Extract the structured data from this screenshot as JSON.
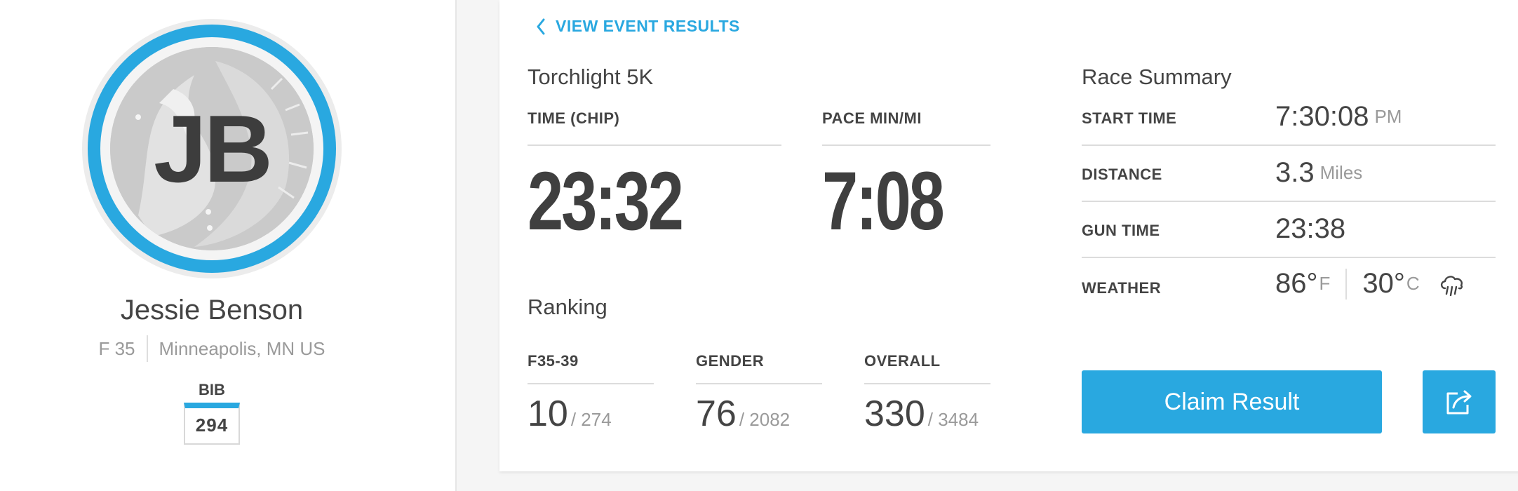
{
  "athlete": {
    "initials": "JB",
    "name": "Jessie Benson",
    "division": "F 35",
    "location": "Minneapolis, MN US",
    "bib_label": "BIB",
    "bib_number": "294"
  },
  "nav": {
    "back_label": "VIEW EVENT RESULTS",
    "back_icon": "chevron-left-icon"
  },
  "result": {
    "event_name": "Torchlight 5K",
    "time_label": "TIME (CHIP)",
    "time_value": "23:32",
    "pace_label": "PACE MIN/MI",
    "pace_value": "7:08"
  },
  "ranking": {
    "title": "Ranking",
    "items": [
      {
        "label": "F35-39",
        "rank": "10",
        "total": "/ 274"
      },
      {
        "label": "GENDER",
        "rank": "76",
        "total": "/ 2082"
      },
      {
        "label": "OVERALL",
        "rank": "330",
        "total": "/ 3484"
      }
    ]
  },
  "summary": {
    "title": "Race Summary",
    "start_time": {
      "label": "START TIME",
      "value": "7:30:08",
      "unit": "PM"
    },
    "distance": {
      "label": "DISTANCE",
      "value": "3.3",
      "unit": "Miles"
    },
    "gun_time": {
      "label": "GUN TIME",
      "value": "23:38"
    },
    "weather": {
      "label": "WEATHER",
      "temp_f": "86°",
      "unit_f": "F",
      "temp_c": "30°",
      "unit_c": "C",
      "icon": "rain-cloud-icon"
    }
  },
  "actions": {
    "claim_label": "Claim Result",
    "share_icon": "share-icon"
  },
  "colors": {
    "accent": "#29a8e0",
    "text": "#444444",
    "muted": "#9a9a9a"
  }
}
